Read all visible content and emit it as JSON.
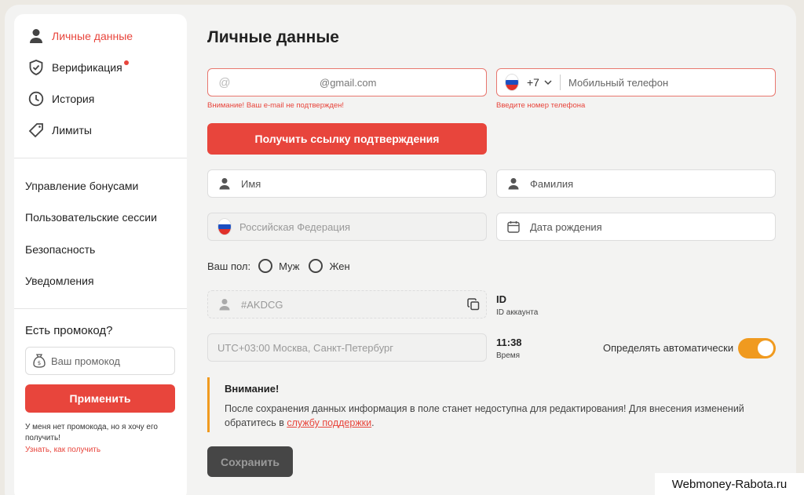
{
  "sidebar": {
    "items": [
      {
        "label": "Личные данные",
        "icon": "user-icon"
      },
      {
        "label": "Верификация",
        "icon": "shield-check-icon"
      },
      {
        "label": "История",
        "icon": "clock-icon"
      },
      {
        "label": "Лимиты",
        "icon": "tag-icon"
      }
    ],
    "links": [
      "Управление бонусами",
      "Пользовательские сессии",
      "Безопасность",
      "Уведомления"
    ],
    "promo": {
      "title": "Есть промокод?",
      "placeholder": "Ваш промокод",
      "button": "Применить",
      "note": "У меня нет промокода, но я хочу его получить!",
      "link": "Узнать, как получить"
    }
  },
  "main": {
    "title": "Личные данные",
    "email": {
      "value": "@gmail.com",
      "error": "Внимание! Ваш e-mail не подтвержден!"
    },
    "phone": {
      "code": "+7",
      "placeholder": "Мобильный телефон",
      "error": "Введите номер телефона"
    },
    "confirm_button": "Получить ссылку подтверждения",
    "first_name_placeholder": "Имя",
    "last_name_placeholder": "Фамилия",
    "country": "Российская Федерация",
    "birthdate_placeholder": "Дата рождения",
    "gender": {
      "label": "Ваш пол:",
      "male": "Муж",
      "female": "Жен"
    },
    "account_id": {
      "value": "#AKDCG",
      "title": "ID",
      "caption": "ID аккаунта"
    },
    "timezone": {
      "value": "UTC+03:00 Москва, Санкт-Петербург",
      "time": "11:38",
      "caption": "Время",
      "auto_label": "Определять автоматически",
      "auto_enabled": true
    },
    "warning": {
      "title": "Внимание!",
      "text": "После сохранения данных информация в поле станет недоступна для редактирования! Для внесения изменений обратитесь в ",
      "link": "службу поддержки",
      "end": "."
    },
    "save_button": "Сохранить"
  },
  "colors": {
    "accent": "#e8453c",
    "toggle": "#f09a1f",
    "save": "#464646"
  },
  "watermark": "Webmoney-Rabota.ru"
}
